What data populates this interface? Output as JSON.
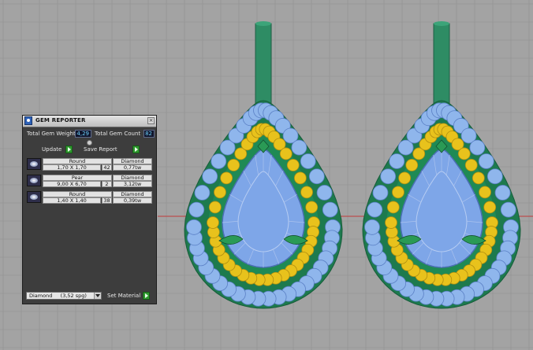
{
  "panel": {
    "title": "GEM REPORTER",
    "close_icon": "close-icon",
    "total_gem_weight_label": "Total Gem Weight",
    "total_gem_weight_value": "4,29",
    "total_gem_count_label": "Total Gem Count",
    "total_gem_count_value": "82",
    "update_label": "Update",
    "save_report_label": "Save Report",
    "gems": [
      {
        "shape": "Round",
        "material": "Diamond",
        "size": "1,70 X 1,70",
        "count": "42",
        "weight": "0,77tw"
      },
      {
        "shape": "Pear",
        "material": "Diamond",
        "size": "9,00 X 6,70",
        "count": "2",
        "weight": "3,12tw"
      },
      {
        "shape": "Round",
        "material": "Diamond",
        "size": "1,40 X 1,40",
        "count": "38",
        "weight": "0,39tw"
      }
    ],
    "material_select_value": "Diamond     (3,52 spg)",
    "set_material_label": "Set Material"
  },
  "colors": {
    "viewport_bg": "#a3a3a3",
    "grid_line": "#8f8f8f",
    "axis_red": "#c03a3a",
    "metal_green": "#2e8c64",
    "melee_blue": "#8fb6ec",
    "melee_yellow": "#e8c21c",
    "center_stone": "#7ea6e8",
    "leaf_green": "#2a9a55"
  }
}
